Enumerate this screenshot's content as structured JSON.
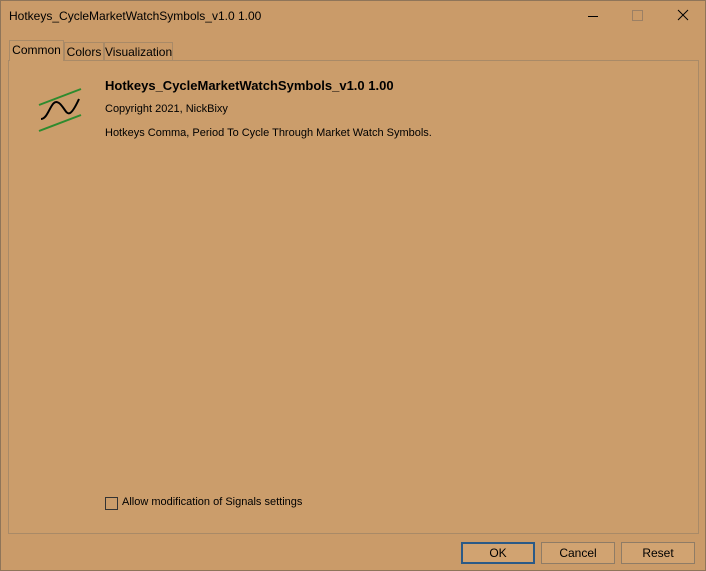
{
  "window": {
    "title": "Hotkeys_CycleMarketWatchSymbols_v1.0 1.00"
  },
  "titlebar_buttons": {
    "minimize_icon": "minimize-icon",
    "maximize_icon": "maximize-icon",
    "close_icon": "close-icon"
  },
  "tabs": [
    {
      "label": "Common",
      "active": true
    },
    {
      "label": "Colors",
      "active": false
    },
    {
      "label": "Visualization",
      "active": false
    }
  ],
  "indicator": {
    "icon": "indicator-sine-wave-icon",
    "icon_color": "#2e8b2e",
    "name": "Hotkeys_CycleMarketWatchSymbols_v1.0 1.00",
    "copyright": "Copyright 2021, NickBixy",
    "description": "Hotkeys Comma, Period To Cycle Through Market Watch Symbols."
  },
  "signals_checkbox": {
    "label": "Allow modification of Signals settings",
    "checked": false
  },
  "buttons": {
    "ok": "OK",
    "cancel": "Cancel",
    "reset": "Reset"
  },
  "colors": {
    "background": "#ca9b69",
    "ok_border": "#2b5a87"
  }
}
